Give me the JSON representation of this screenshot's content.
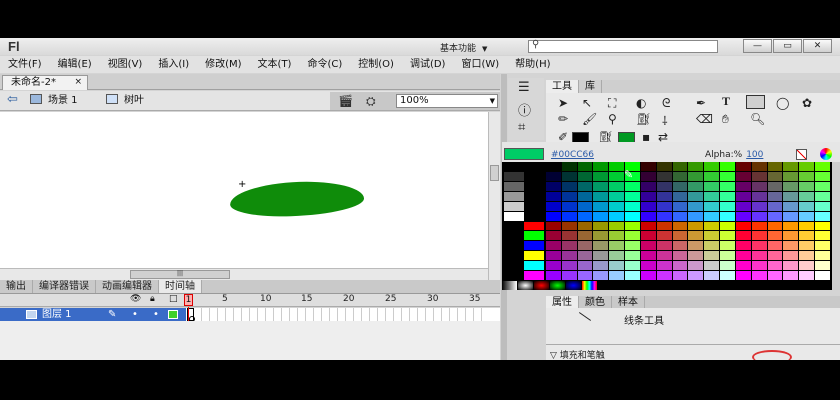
{
  "app": {
    "logo": "Fl",
    "workspace": "基本功能",
    "search_placeholder": "",
    "window_buttons": [
      "—",
      "▭",
      "✕"
    ]
  },
  "menu": [
    "文件(F)",
    "编辑(E)",
    "视图(V)",
    "插入(I)",
    "修改(M)",
    "文本(T)",
    "命令(C)",
    "控制(O)",
    "调试(D)",
    "窗口(W)",
    "帮助(H)"
  ],
  "document": {
    "tab_title": "未命名-2*",
    "close": "×"
  },
  "editbar": {
    "scene": "场景 1",
    "symbol": "树叶",
    "zoom": "100%"
  },
  "bottom_tabs": [
    "输出",
    "编译器错误",
    "动画编辑器",
    "时间轴"
  ],
  "timeline": {
    "ruler": [
      "1",
      "5",
      "10",
      "15",
      "20",
      "25",
      "30",
      "35"
    ],
    "layer_name": "图层 1",
    "current_frame": "1"
  },
  "tools_panel": {
    "tabs": [
      "工具",
      "库"
    ]
  },
  "color": {
    "hex": "#00CC66",
    "alpha_label": "Alpha:%",
    "alpha_value": "100",
    "fill": "#00CC66",
    "stroke": "#000000"
  },
  "properties": {
    "tabs": [
      "属性",
      "颜色",
      "样本"
    ],
    "tool_name": "线条工具",
    "section": "填充和笔触"
  }
}
